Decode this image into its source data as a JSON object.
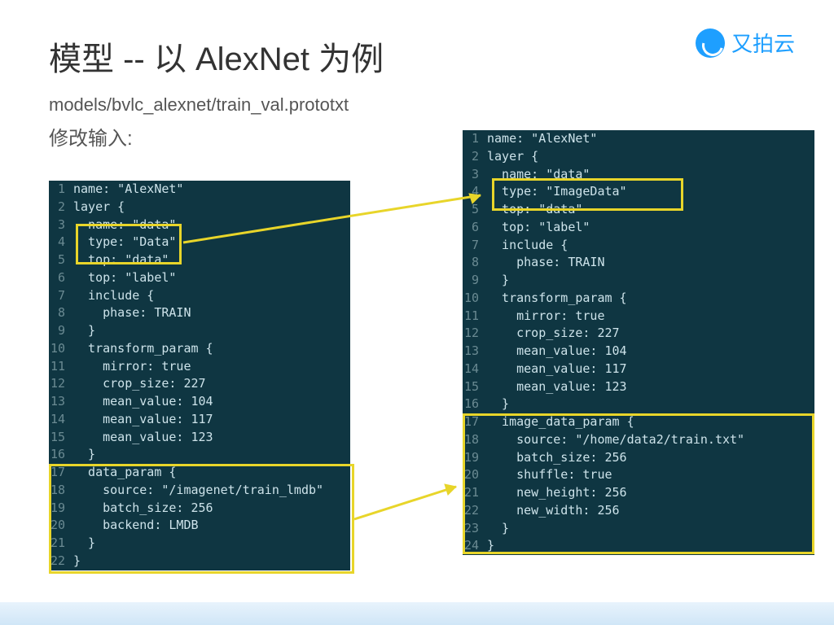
{
  "title": "模型 -- 以 AlexNet 为例",
  "subtitle": "models/bvlc_alexnet/train_val.prototxt",
  "label": "修改输入:",
  "logo_text": "又拍云",
  "code_left": [
    "name: \"AlexNet\"",
    "layer {",
    "  name: \"data\"",
    "  type: \"Data\"",
    "  top: \"data\"",
    "  top: \"label\"",
    "  include {",
    "    phase: TRAIN",
    "  }",
    "  transform_param {",
    "    mirror: true",
    "    crop_size: 227",
    "    mean_value: 104",
    "    mean_value: 117",
    "    mean_value: 123",
    "  }",
    "  data_param {",
    "    source: \"/imagenet/train_lmdb\"",
    "    batch_size: 256",
    "    backend: LMDB",
    "  }",
    "}"
  ],
  "code_right": [
    "name: \"AlexNet\"",
    "layer {",
    "  name: \"data\"",
    "  type: \"ImageData\"",
    "  top: \"data\"",
    "  top: \"label\"",
    "  include {",
    "    phase: TRAIN",
    "  }",
    "  transform_param {",
    "    mirror: true",
    "    crop_size: 227",
    "    mean_value: 104",
    "    mean_value: 117",
    "    mean_value: 123",
    "  }",
    "  image_data_param {",
    "    source: \"/home/data2/train.txt\"",
    "    batch_size: 256",
    "    shuffle: true",
    "    new_height: 256",
    "    new_width: 256",
    "  }",
    "}"
  ]
}
